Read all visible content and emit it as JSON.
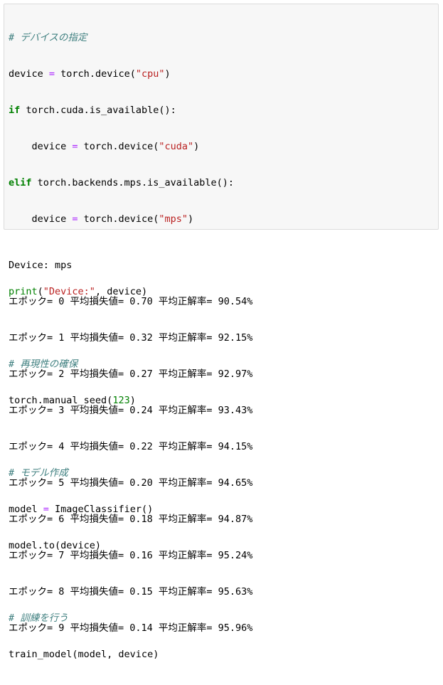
{
  "code_cell": {
    "lines": {
      "l1": "# デバイスの指定",
      "l2": {
        "a": "device ",
        "eq": "=",
        "b": " torch.device(",
        "s": "\"cpu\"",
        "c": ")"
      },
      "l3": {
        "kw": "if",
        "b": " torch.cuda.is_available():"
      },
      "l4": {
        "a": "    device ",
        "eq": "=",
        "b": " torch.device(",
        "s": "\"cuda\"",
        "c": ")"
      },
      "l5": {
        "kw": "elif",
        "b": " torch.backends.mps.is_available():"
      },
      "l6": {
        "a": "    device ",
        "eq": "=",
        "b": " torch.device(",
        "s": "\"mps\"",
        "c": ")"
      },
      "l8": {
        "fn": "print",
        "a": "(",
        "s": "\"Device:\"",
        "b": ", device)"
      },
      "l10": "# 再現性の確保",
      "l11": {
        "a": "torch.manual_seed(",
        "n": "123",
        "b": ")"
      },
      "l13": "# モデル作成",
      "l14": {
        "a": "model ",
        "eq": "=",
        "b": " ImageClassifier()"
      },
      "l15": "model.to(device)",
      "l17": "# 訓練を行う",
      "l18": "train_model(model, device)"
    }
  },
  "output": {
    "device_line": "Device: mps",
    "epochs": [
      "エポック= 0 平均損失値= 0.70 平均正解率= 90.54%",
      "エポック= 1 平均損失値= 0.32 平均正解率= 92.15%",
      "エポック= 2 平均損失値= 0.27 平均正解率= 92.97%",
      "エポック= 3 平均損失値= 0.24 平均正解率= 93.43%",
      "エポック= 4 平均損失値= 0.22 平均正解率= 94.15%",
      "エポック= 5 平均損失値= 0.20 平均正解率= 94.65%",
      "エポック= 6 平均損失値= 0.18 平均正解率= 94.87%",
      "エポック= 7 平均損失値= 0.16 平均正解率= 95.24%",
      "エポック= 8 平均損失値= 0.15 平均正解率= 95.63%",
      "エポック= 9 平均損失値= 0.14 平均正解率= 95.96%"
    ]
  }
}
